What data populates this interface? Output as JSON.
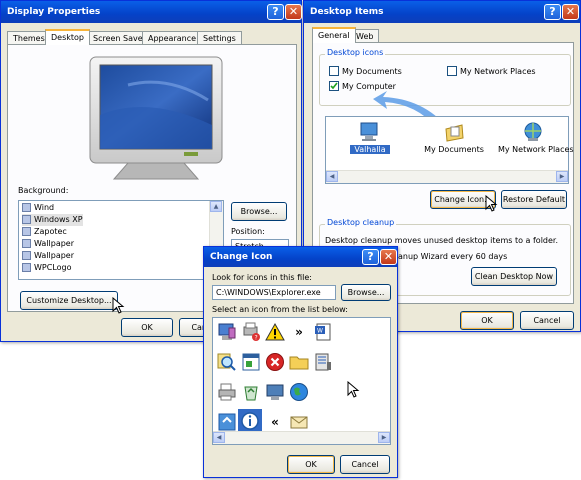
{
  "display_properties": {
    "title": "Display Properties",
    "tabs": [
      "Themes",
      "Desktop",
      "Screen Saver",
      "Appearance",
      "Settings"
    ],
    "active_tab": "Desktop",
    "background_label": "Background:",
    "backgrounds": [
      "Wind",
      "Windows XP",
      "Zapotec",
      "Wallpaper",
      "Wallpaper",
      "WPCLogo"
    ],
    "selected_background": "Windows XP",
    "browse_label": "Browse...",
    "position_label": "Position:",
    "position_value": "Stretch",
    "customize_label": "Customize Desktop...",
    "ok_label": "OK",
    "cancel_label": "Cancel"
  },
  "desktop_items": {
    "title": "Desktop Items",
    "tabs": [
      "General",
      "Web"
    ],
    "icons_group_label": "Desktop icons",
    "checkboxes": [
      {
        "label": "My Documents",
        "checked": false
      },
      {
        "label": "My Network Places",
        "checked": false
      },
      {
        "label": "My Computer",
        "checked": true
      }
    ],
    "icon_items": [
      "Valhalla",
      "My Documents",
      "My Network Places"
    ],
    "change_icon_label": "Change Icon...",
    "restore_default_label": "Restore Default",
    "cleanup_group_label": "Desktop cleanup",
    "cleanup_text": "Desktop cleanup moves unused desktop items to a folder.",
    "cleanup_wizard_text": "anup Wizard every 60 days",
    "clean_now_label": "Clean Desktop Now",
    "ok_label": "OK",
    "cancel_label": "Cancel"
  },
  "change_icon": {
    "title": "Change Icon",
    "look_for_label": "Look for icons in this file:",
    "file_path": "C:\\WINDOWS\\Explorer.exe",
    "browse_label": "Browse...",
    "select_label": "Select an icon from the list below:",
    "ok_label": "OK",
    "cancel_label": "Cancel"
  }
}
